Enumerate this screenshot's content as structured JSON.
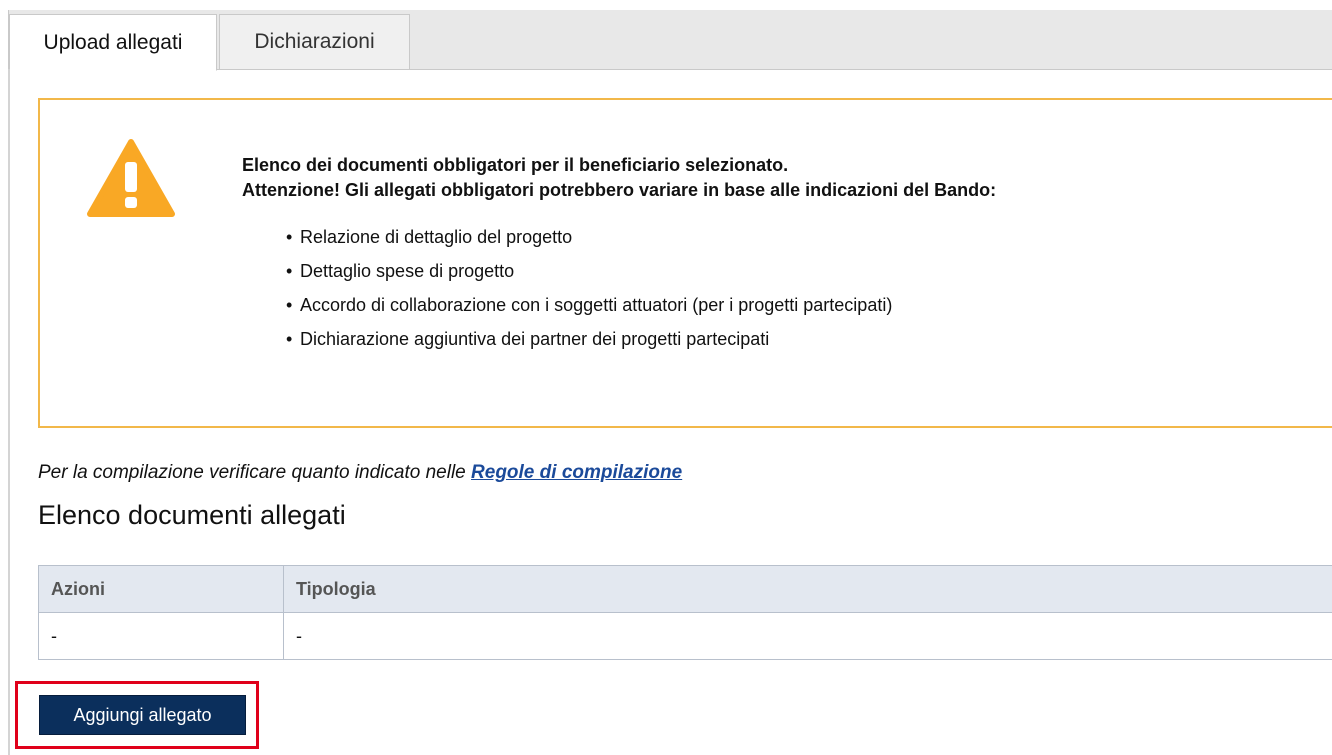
{
  "tabs": [
    {
      "label": "Upload allegati",
      "active": true
    },
    {
      "label": "Dichiarazioni",
      "active": false
    }
  ],
  "warning": {
    "icon": "warning-triangle-icon",
    "color": "#f9a825",
    "title_line1": "Elenco dei documenti obbligatori per il beneficiario selezionato.",
    "title_line2": "Attenzione! Gli allegati obbligatori potrebbero variare in base alle indicazioni del Bando:",
    "items": [
      "Relazione di dettaglio del progetto",
      "Dettaglio spese di progetto",
      "Accordo di collaborazione con i soggetti attuatori (per i progetti partecipati)",
      "Dichiarazione aggiuntiva dei partner dei progetti partecipati"
    ]
  },
  "hint": {
    "text": "Per la compilazione verificare quanto indicato nelle",
    "link": "Regole di compilazione"
  },
  "section_title": "Elenco documenti allegati",
  "table": {
    "headers": [
      "Azioni",
      "Tipologia"
    ],
    "rows": [
      [
        "-",
        "-"
      ]
    ]
  },
  "add_button": {
    "label": "Aggiungi allegato"
  }
}
